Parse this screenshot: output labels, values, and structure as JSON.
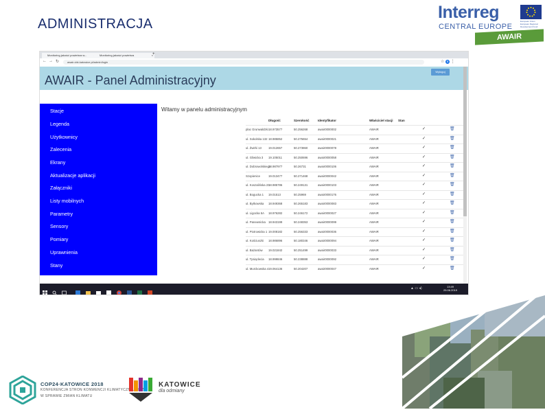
{
  "slide": {
    "title": "ADMINISTRACJA"
  },
  "interreg_logo": {
    "brand": "Interreg",
    "program": "CENTRAL EUROPE",
    "eu_caption": "European Union European Regional Development Fund",
    "project": "AWAIR"
  },
  "browser": {
    "tabs": [
      {
        "label": "Monitoring jakości powietrza w..."
      },
      {
        "label": "Monitoring jakości powietrza"
      }
    ],
    "url": "awair.cbk.katowice.pl/admin/login",
    "account_badge": "B"
  },
  "app": {
    "header_title": "AWAIR - Panel Administracyjny",
    "login_button": "Wyloguj",
    "welcome": "Witamy w panelu administracyjnym",
    "sidebar_items": [
      {
        "label": "Stacje"
      },
      {
        "label": "Legenda"
      },
      {
        "label": "Użytkownicy"
      },
      {
        "label": "Zalecenia"
      },
      {
        "label": "Ekrany"
      },
      {
        "label": "Aktualizacje aplikacji"
      },
      {
        "label": "Załączniki"
      },
      {
        "label": "Listy mobilnych"
      },
      {
        "label": "Parametry"
      },
      {
        "label": "Sensory"
      },
      {
        "label": "Pomiary"
      },
      {
        "label": "Uprawnienia"
      },
      {
        "label": "Stany"
      }
    ],
    "table": {
      "columns": [
        "Długość",
        "Szerokość",
        "Identyfikator",
        "Właściciel stacji",
        "Stan"
      ],
      "rows": [
        {
          "name": "plac Grunwaldzki",
          "lng": "18.973577",
          "lat": "50.256268",
          "id": "awair0000002",
          "owner": "AWAIR"
        },
        {
          "name": "ul. Sokolska 132",
          "lng": "18.985852",
          "lat": "50.275654",
          "id": "awair0000021",
          "owner": "AWAIR"
        },
        {
          "name": "ul. Żwirki 13",
          "lng": "19.012657",
          "lat": "50.273860",
          "id": "awair0000078",
          "owner": "AWAIR"
        },
        {
          "name": "ul. Gliwicka 3",
          "lng": "19.105011",
          "lat": "50.250696",
          "id": "awair0000058",
          "owner": "AWAIR"
        },
        {
          "name": "ul. Dobrowolskiego",
          "lng": "18.987977",
          "lat": "50.26731",
          "id": "awair0000106",
          "owner": "AWAIR"
        },
        {
          "name": "Szopienice",
          "lng": "19.013477",
          "lat": "50.271468",
          "id": "awair0000042",
          "owner": "AWAIR"
        },
        {
          "name": "ul. Koszalińska 23",
          "lng": "18.985786",
          "lat": "50.249131",
          "id": "awair0000103",
          "owner": "AWAIR"
        },
        {
          "name": "ul. Bogucka 1",
          "lng": "19.01513",
          "lat": "50.25969",
          "id": "awair0000176",
          "owner": "AWAIR"
        },
        {
          "name": "ul. Bytkowska",
          "lng": "18.949368",
          "lat": "50.265183",
          "id": "awair0000083",
          "owner": "AWAIR"
        },
        {
          "name": "ul. Ligocka 5A",
          "lng": "18.976282",
          "lat": "50.246172",
          "id": "awair0000027",
          "owner": "AWAIR"
        },
        {
          "name": "ul. Panewnicka",
          "lng": "18.943199",
          "lat": "50.248353",
          "id": "awair0000099",
          "owner": "AWAIR"
        },
        {
          "name": "ul. Piotrowicka 1",
          "lng": "19.008182",
          "lat": "50.256333",
          "id": "awair0000036",
          "owner": "AWAIR"
        },
        {
          "name": "ul. Kościuszki",
          "lng": "18.986896",
          "lat": "50.180346",
          "id": "awair0000094",
          "owner": "AWAIR"
        },
        {
          "name": "ul. Bażantów",
          "lng": "19.021842",
          "lat": "50.251499",
          "id": "awair0000033",
          "owner": "AWAIR"
        },
        {
          "name": "ul. Tysiąclecia",
          "lng": "18.999846",
          "lat": "50.238888",
          "id": "awair0000092",
          "owner": "AWAIR"
        },
        {
          "name": "ul. Murckowska 4",
          "lng": "19.064136",
          "lat": "50.204207",
          "id": "awair0000047",
          "owner": "AWAIR"
        }
      ],
      "row_check": "✓",
      "row_delete": "🗑"
    }
  },
  "taskbar": {
    "time": "13:49",
    "date": "25.06.2019"
  },
  "footer": {
    "cop_title": "COP24·KATOWICE 2018",
    "cop_sub1": "KONFERENCJA STRON KONWENCJI KLIMATYCZNEJ ONZ",
    "cop_sub2": "W SPRAWIE ZMIAN KLIMATU",
    "city": "KATOWICE",
    "city_tagline": "dla odmiany"
  },
  "colors": {
    "header": "#add8e6",
    "sidebar": "#0000ff",
    "title": "#1a2e6e",
    "interreg": "#3a5fa8",
    "awair_green": "#5a9b3a"
  }
}
